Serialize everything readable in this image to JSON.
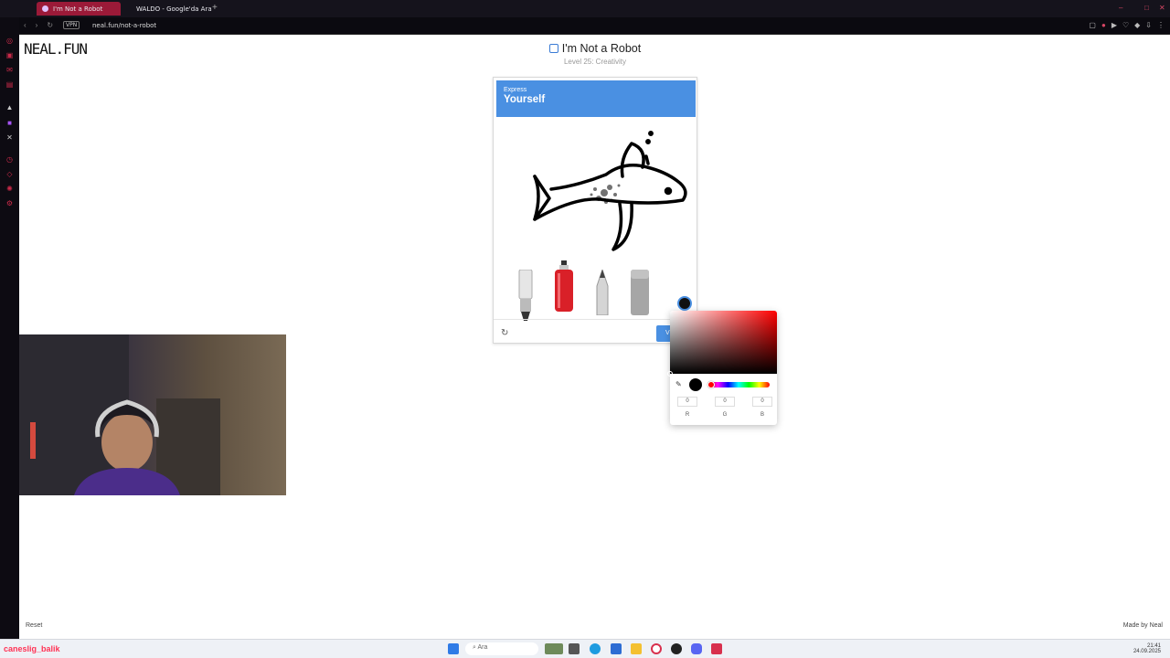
{
  "browser": {
    "tabs": [
      {
        "label": "I'm Not a Robot",
        "active": true
      },
      {
        "label": "WALDO - Google'da Ara",
        "active": false
      }
    ],
    "vpn_badge": "VPN",
    "url": "neal.fun/not-a-robot"
  },
  "page": {
    "logo": "NEAL.FUN",
    "title": "I'm Not a Robot",
    "subtitle": "Level 25: Creativity",
    "captcha": {
      "header_small": "Express",
      "header_big": "Yourself",
      "verify_label": "V"
    },
    "color_picker": {
      "r": "0",
      "g": "0",
      "b": "0",
      "labels": [
        "R",
        "G",
        "B"
      ],
      "selected_color": "#000000"
    },
    "reset_label": "Reset",
    "made_by": "Made by Neal"
  },
  "taskbar": {
    "search_placeholder": "Ara",
    "time": "21:41",
    "date": "24.09.2025",
    "watermark": "caneslig_balik"
  },
  "colors": {
    "accent_blue": "#4a90e2",
    "tab_active": "#9b1a38"
  }
}
